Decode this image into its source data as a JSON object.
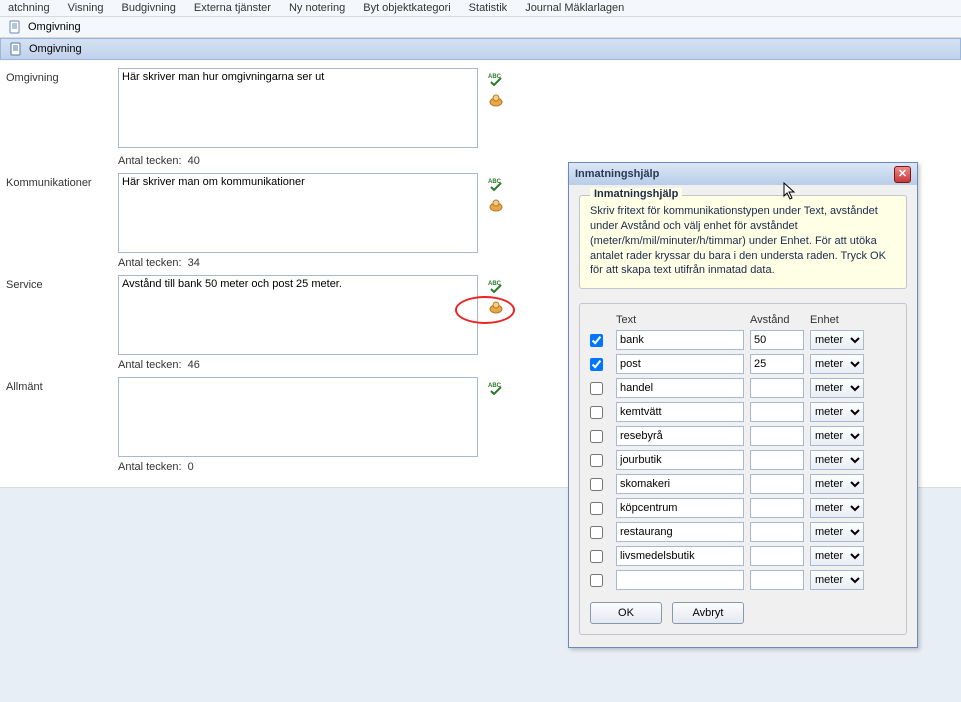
{
  "menu": [
    "atchning",
    "Visning",
    "Budgivning",
    "Externa tjänster",
    "Ny notering",
    "Byt objektkategori",
    "Statistik",
    "Journal Mäklarlagen"
  ],
  "section_title": "Omgivning",
  "panel_title": "Omgivning",
  "char_count_label": "Antal tecken:",
  "fields": {
    "omgivning": {
      "label": "Omgivning",
      "value": "Här skriver man hur omgivningarna ser ut",
      "count": "40"
    },
    "kommunikationer": {
      "label": "Kommunikationer",
      "value": "Här skriver man om kommunikationer",
      "count": "34"
    },
    "service": {
      "label": "Service",
      "value": "Avstånd till bank 50 meter och post 25 meter.",
      "count": "46"
    },
    "allmant": {
      "label": "Allmänt",
      "value": "",
      "count": "0"
    }
  },
  "dialog": {
    "title": "Inmatningshjälp",
    "help_legend": "Inmatningshjälp",
    "help_body": "  Skriv fritext för kommunikationstypen under Text, avståndet under Avstånd och välj enhet för avståndet (meter/km/mil/minuter/h/timmar) under Enhet.\n  För att utöka antalet rader kryssar du bara i den understa raden. Tryck OK för att skapa text utifrån inmatad data.",
    "headers": {
      "text": "Text",
      "avstand": "Avstånd",
      "enhet": "Enhet"
    },
    "rows": [
      {
        "checked": true,
        "text": "bank",
        "distance": "50",
        "unit": "meter"
      },
      {
        "checked": true,
        "text": "post",
        "distance": "25",
        "unit": "meter"
      },
      {
        "checked": false,
        "text": "handel",
        "distance": "",
        "unit": "meter"
      },
      {
        "checked": false,
        "text": "kemtvätt",
        "distance": "",
        "unit": "meter"
      },
      {
        "checked": false,
        "text": "resebyrå",
        "distance": "",
        "unit": "meter"
      },
      {
        "checked": false,
        "text": "jourbutik",
        "distance": "",
        "unit": "meter"
      },
      {
        "checked": false,
        "text": "skomakeri",
        "distance": "",
        "unit": "meter"
      },
      {
        "checked": false,
        "text": "köpcentrum",
        "distance": "",
        "unit": "meter"
      },
      {
        "checked": false,
        "text": "restaurang",
        "distance": "",
        "unit": "meter"
      },
      {
        "checked": false,
        "text": "livsmedelsbutik",
        "distance": "",
        "unit": "meter"
      },
      {
        "checked": false,
        "text": "",
        "distance": "",
        "unit": "meter"
      }
    ],
    "ok_label": "OK",
    "cancel_label": "Avbryt"
  }
}
